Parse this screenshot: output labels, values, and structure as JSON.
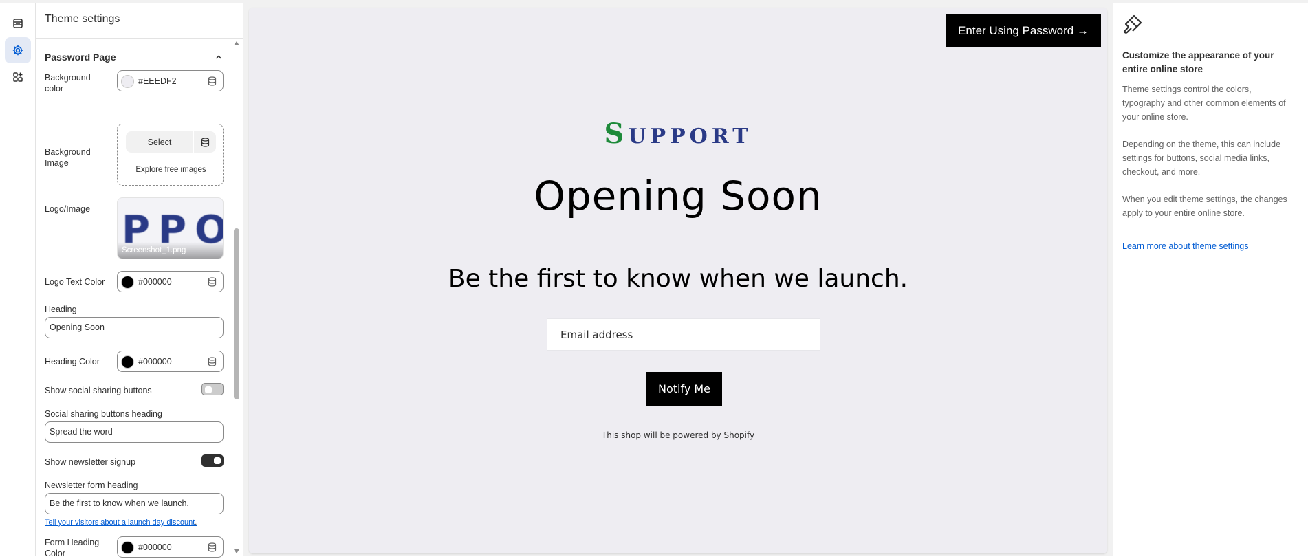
{
  "rail": {
    "items": [
      {
        "name": "sections-icon"
      },
      {
        "name": "gear-icon"
      },
      {
        "name": "apps-icon"
      }
    ]
  },
  "panel": {
    "title": "Theme settings",
    "section_title": "Password Page",
    "background_color": {
      "label": "Background color",
      "value": "#EEEDF2",
      "swatch": "#EEEDF2"
    },
    "background_image": {
      "label": "Background Image",
      "select_label": "Select",
      "explore_label": "Explore free images"
    },
    "logo_image": {
      "label": "Logo/Image",
      "file_name": "Screenshot_1.png",
      "thumb_letters": "PPO"
    },
    "logo_text_color": {
      "label": "Logo Text Color",
      "value": "#000000",
      "swatch": "#000000"
    },
    "heading": {
      "label": "Heading",
      "value": "Opening Soon"
    },
    "heading_color": {
      "label": "Heading Color",
      "value": "#000000",
      "swatch": "#000000"
    },
    "show_social": {
      "label": "Show social sharing buttons",
      "checked": false
    },
    "social_heading": {
      "label": "Social sharing buttons heading",
      "value": "Spread the word"
    },
    "show_newsletter": {
      "label": "Show newsletter signup",
      "checked": true
    },
    "newsletter_heading": {
      "label": "Newsletter form heading",
      "value": "Be the first to know when we launch."
    },
    "discount_link": {
      "label": "Tell your visitors about a launch day discount",
      "suffix": "."
    },
    "form_heading_color": {
      "label": "Form Heading Color",
      "value": "#000000",
      "swatch": "#000000"
    }
  },
  "preview": {
    "password_button": "Enter Using Password →",
    "logo_first_letter": "S",
    "logo_rest": "UPPORT",
    "heading": "Opening Soon",
    "form_heading": "Be the first to know when we launch.",
    "email_placeholder": "Email address",
    "notify_button": "Notify Me",
    "powered_by": "This shop will be powered by Shopify",
    "background": "#EEEDF2"
  },
  "info": {
    "title": "Customize the appearance of your entire online store",
    "paragraphs": [
      "Theme settings control the colors, typography and other common elements of your online store.",
      "Depending on the theme, this can include settings for buttons, social media links, checkout, and more.",
      "When you edit theme settings, the changes apply to your entire online store."
    ],
    "link": "Learn more about theme settings"
  },
  "colors": {
    "accent_link": "#005bd3",
    "active_rail": "#e3e9f5",
    "logo_blue": "#2a3a86",
    "logo_green": "#1e8a3a"
  }
}
